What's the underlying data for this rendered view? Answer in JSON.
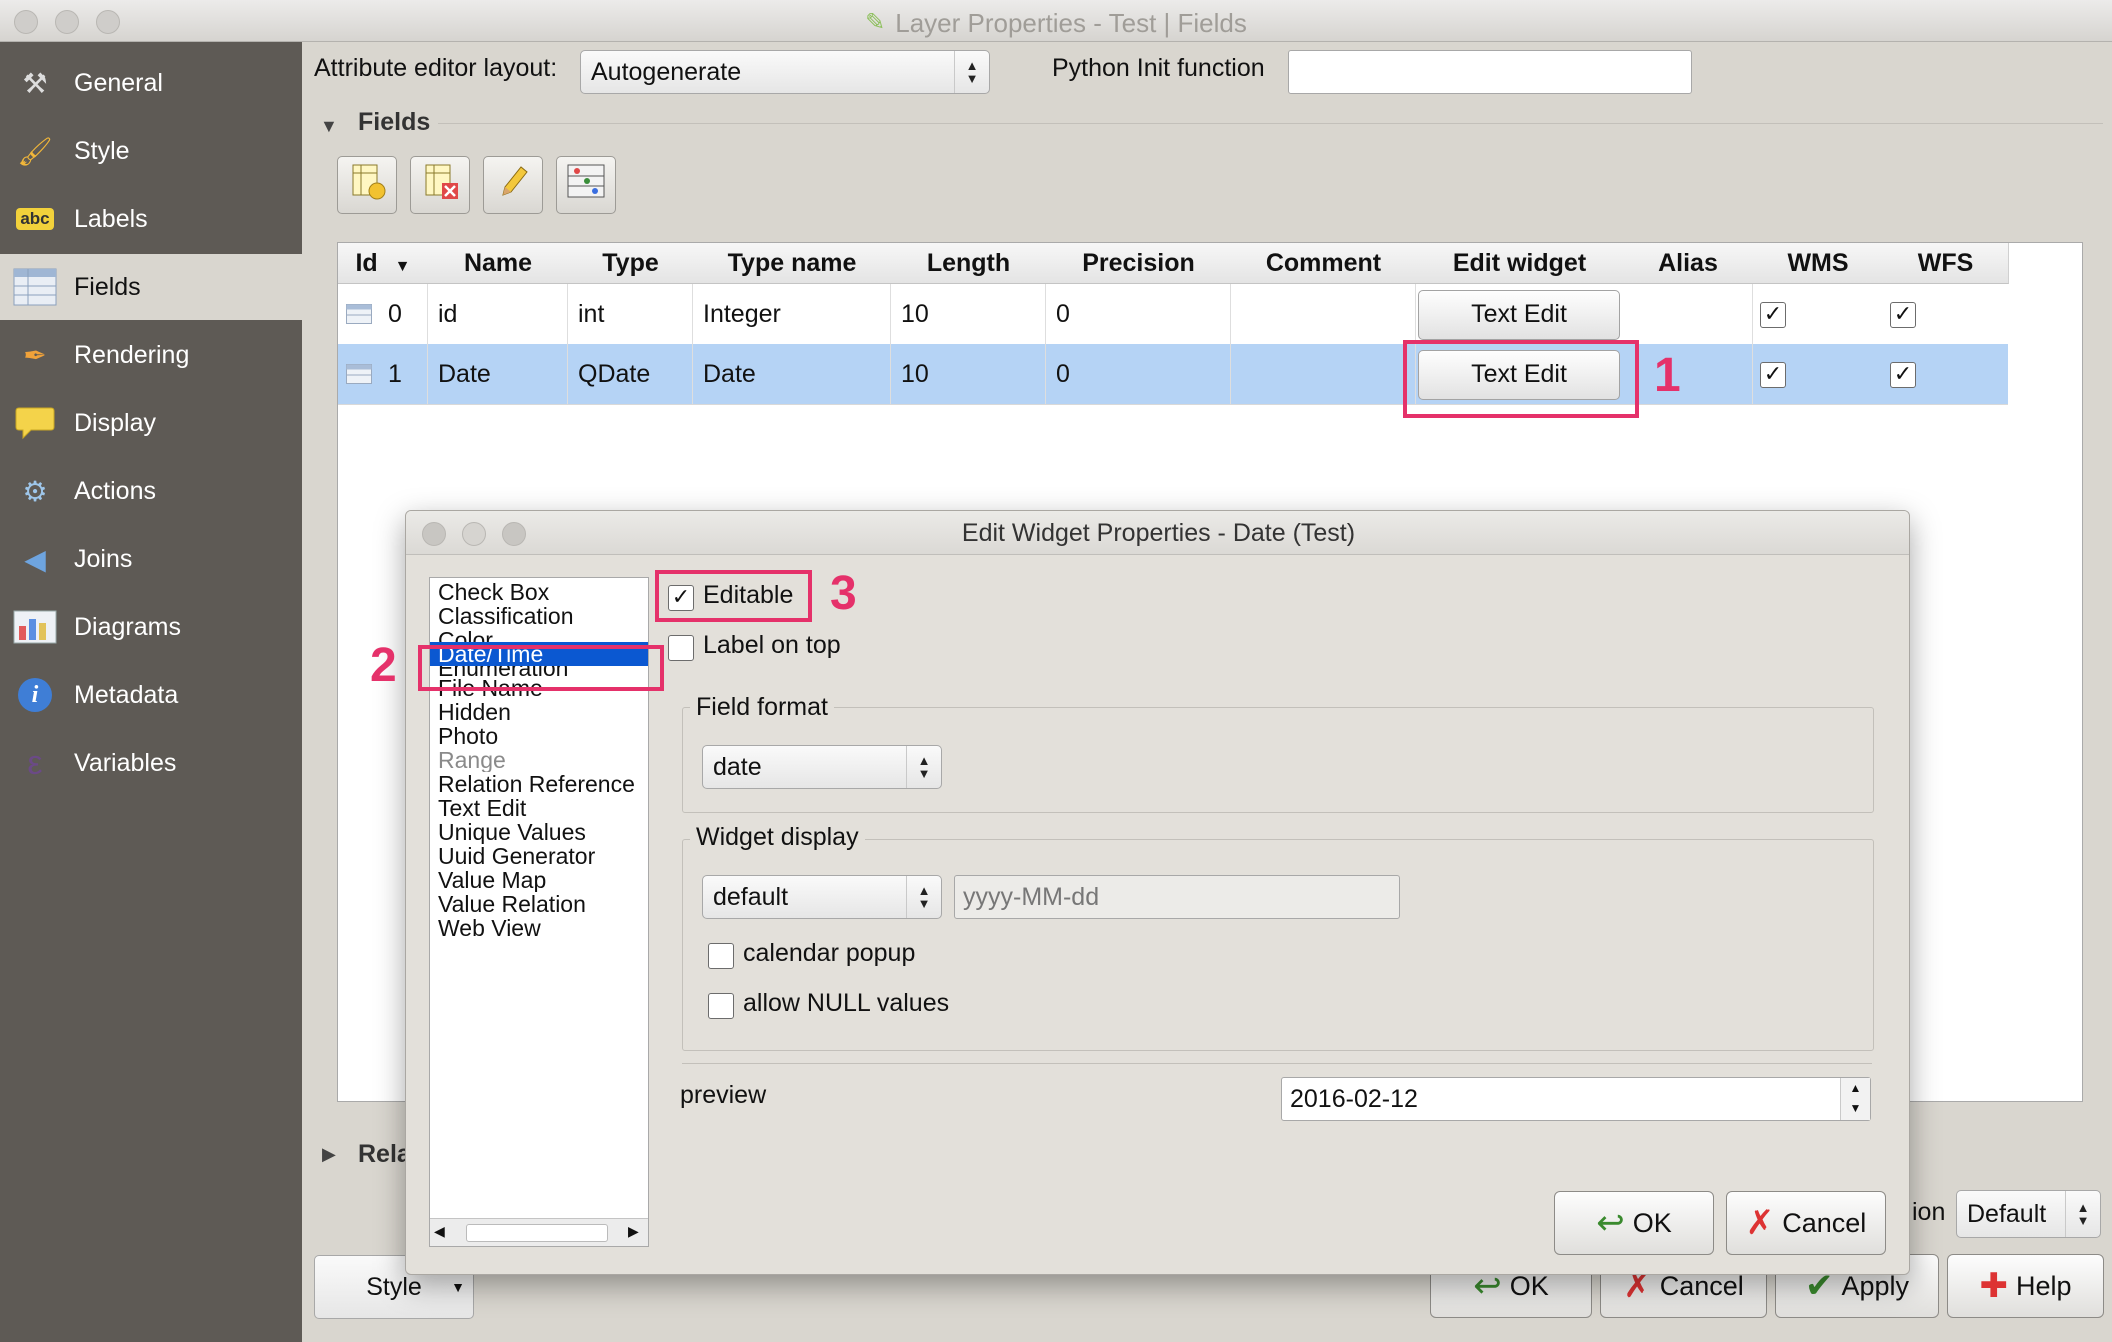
{
  "window": {
    "title": "Layer Properties - Test | Fields"
  },
  "sidebar": {
    "items": [
      {
        "label": "General",
        "icon": "wrench-hammer-icon"
      },
      {
        "label": "Style",
        "icon": "paintbrush-icon"
      },
      {
        "label": "Labels",
        "icon": "abc-label-icon",
        "icon_text": "abc"
      },
      {
        "label": "Fields",
        "icon": "table-icon",
        "active": true
      },
      {
        "label": "Rendering",
        "icon": "brush-icon"
      },
      {
        "label": "Display",
        "icon": "speech-bubble-icon"
      },
      {
        "label": "Actions",
        "icon": "gear-icon"
      },
      {
        "label": "Joins",
        "icon": "join-arrow-icon"
      },
      {
        "label": "Diagrams",
        "icon": "diagram-icon"
      },
      {
        "label": "Metadata",
        "icon": "info-icon",
        "icon_text": "i"
      },
      {
        "label": "Variables",
        "icon": "epsilon-icon",
        "icon_text": "ε"
      }
    ]
  },
  "top": {
    "layout_label": "Attribute editor layout:",
    "layout_value": "Autogenerate",
    "python_label": "Python Init function",
    "python_value": ""
  },
  "fields_section": {
    "title": "Fields",
    "toolbar": [
      "new-field-icon",
      "delete-field-icon",
      "toggle-edit-icon",
      "field-calculator-icon"
    ]
  },
  "table": {
    "columns": [
      "Id",
      "Name",
      "Type",
      "Type name",
      "Length",
      "Precision",
      "Comment",
      "Edit widget",
      "Alias",
      "WMS",
      "WFS"
    ],
    "rows": [
      {
        "id": "0",
        "name": "id",
        "type": "int",
        "type_name": "Integer",
        "length": "10",
        "precision": "0",
        "comment": "",
        "edit_widget": "Text Edit",
        "alias": "",
        "wms": true,
        "wfs": true
      },
      {
        "id": "1",
        "name": "Date",
        "type": "QDate",
        "type_name": "Date",
        "length": "10",
        "precision": "0",
        "comment": "",
        "edit_widget": "Text Edit",
        "alias": "",
        "wms": true,
        "wfs": true,
        "selected": true
      }
    ]
  },
  "relations_section": {
    "title": "Rela"
  },
  "bottom": {
    "style_label": "Style",
    "default_label": "Default",
    "partial_label": "ion",
    "ok": "OK",
    "cancel": "Cancel",
    "apply": "Apply",
    "help": "Help"
  },
  "dialog": {
    "title": "Edit Widget Properties - Date (Test)",
    "widgets": [
      "Check Box",
      "Classification",
      "Color",
      "Date/Time",
      "Enumeration",
      "File Name",
      "Hidden",
      "Photo",
      "Range",
      "Relation Reference",
      "Text Edit",
      "Unique Values",
      "Uuid Generator",
      "Value Map",
      "Value Relation",
      "Web View"
    ],
    "selected_widget": "Date/Time",
    "editable_label": "Editable",
    "editable_checked": true,
    "label_on_top": "Label on top",
    "label_on_top_checked": false,
    "field_format_title": "Field format",
    "field_format_value": "date",
    "widget_display_title": "Widget display",
    "widget_display_value": "default",
    "display_format": "yyyy-MM-dd",
    "calendar_popup": "calendar popup",
    "calendar_popup_checked": false,
    "allow_null": "allow NULL values",
    "allow_null_checked": false,
    "preview_label": "preview",
    "preview_value": "2016-02-12",
    "ok": "OK",
    "cancel": "Cancel"
  },
  "annotations": [
    "1",
    "2",
    "3"
  ],
  "colors": {
    "annotation": "#e5316a",
    "selection": "#0b58d1",
    "row_selected": "#b5d3f5",
    "sidebar_bg": "#5e5a55"
  }
}
